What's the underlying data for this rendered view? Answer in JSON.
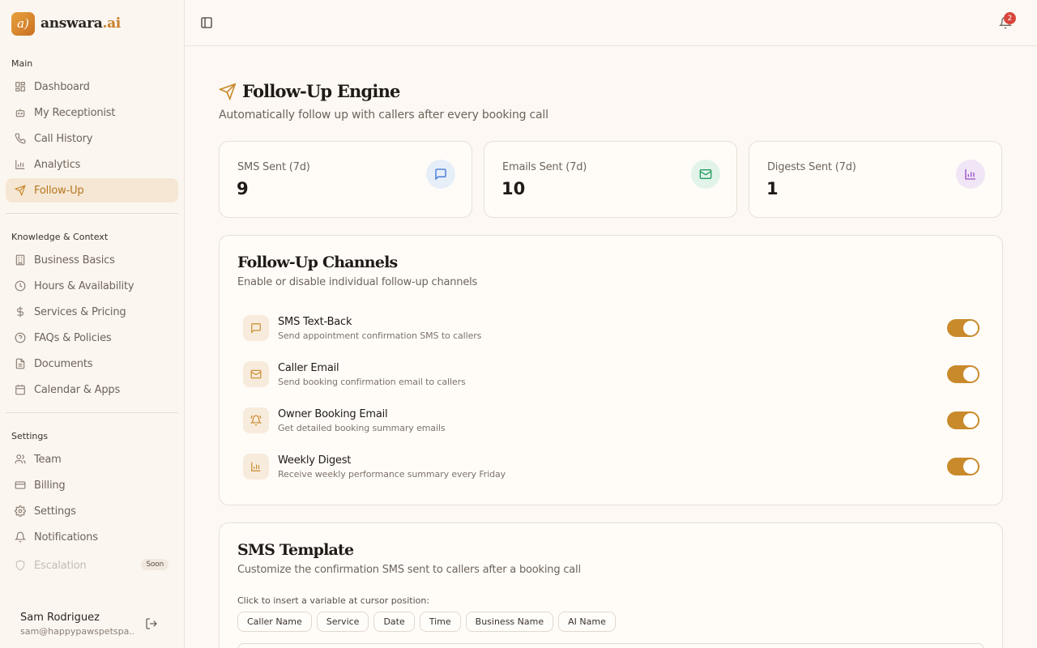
{
  "brand": {
    "logo_text": "a)",
    "name": "answara",
    "tld": ".ai"
  },
  "sidebar": {
    "sections": {
      "main": "Main",
      "knowledge": "Knowledge & Context",
      "settings": "Settings"
    },
    "main_items": [
      {
        "label": "Dashboard",
        "icon": "grid-icon"
      },
      {
        "label": "My Receptionist",
        "icon": "bot-icon"
      },
      {
        "label": "Call History",
        "icon": "phone-icon"
      },
      {
        "label": "Analytics",
        "icon": "bar-chart-icon"
      },
      {
        "label": "Follow-Up",
        "icon": "send-icon",
        "active": true
      }
    ],
    "knowledge_items": [
      {
        "label": "Business Basics",
        "icon": "building-icon"
      },
      {
        "label": "Hours & Availability",
        "icon": "clock-icon"
      },
      {
        "label": "Services & Pricing",
        "icon": "dollar-icon"
      },
      {
        "label": "FAQs & Policies",
        "icon": "help-circle-icon"
      },
      {
        "label": "Documents",
        "icon": "file-icon"
      },
      {
        "label": "Calendar & Apps",
        "icon": "calendar-icon"
      }
    ],
    "settings_items": [
      {
        "label": "Team",
        "icon": "users-icon"
      },
      {
        "label": "Billing",
        "icon": "credit-card-icon"
      },
      {
        "label": "Settings",
        "icon": "gear-icon"
      },
      {
        "label": "Notifications",
        "icon": "bell-icon"
      },
      {
        "label": "Escalation",
        "icon": "shield-icon",
        "disabled": true,
        "badge": "Soon"
      }
    ],
    "user": {
      "name": "Sam Rodriguez",
      "email": "sam@happypawspetspa...."
    }
  },
  "topbar": {
    "notification_count": "2"
  },
  "page": {
    "title": "Follow-Up Engine",
    "subtitle": "Automatically follow up with callers after every booking call"
  },
  "stats": [
    {
      "label": "SMS Sent (7d)",
      "value": "9",
      "icon": "message-icon",
      "bg": "#e6eef8",
      "fg": "#3b74d6"
    },
    {
      "label": "Emails Sent (7d)",
      "value": "10",
      "icon": "mail-icon",
      "bg": "#e2f3ea",
      "fg": "#1f9d5c"
    },
    {
      "label": "Digests Sent (7d)",
      "value": "1",
      "icon": "bar-chart-icon",
      "bg": "#f1e6f6",
      "fg": "#9a4fc4"
    }
  ],
  "channels": {
    "title": "Follow-Up Channels",
    "subtitle": "Enable or disable individual follow-up channels",
    "items": [
      {
        "name": "SMS Text-Back",
        "desc": "Send appointment confirmation SMS to callers",
        "icon": "message-icon",
        "enabled": true
      },
      {
        "name": "Caller Email",
        "desc": "Send booking confirmation email to callers",
        "icon": "mail-icon",
        "enabled": true
      },
      {
        "name": "Owner Booking Email",
        "desc": "Get detailed booking summary emails",
        "icon": "bell-ring-icon",
        "enabled": true
      },
      {
        "name": "Weekly Digest",
        "desc": "Receive weekly performance summary every Friday",
        "icon": "bar-chart-icon",
        "enabled": true
      }
    ]
  },
  "sms_template": {
    "title": "SMS Template",
    "subtitle": "Customize the confirmation SMS sent to callers after a booking call",
    "hint": "Click to insert a variable at cursor position:",
    "variables": [
      "Caller Name",
      "Service",
      "Date",
      "Time",
      "Business Name",
      "AI Name"
    ]
  }
}
